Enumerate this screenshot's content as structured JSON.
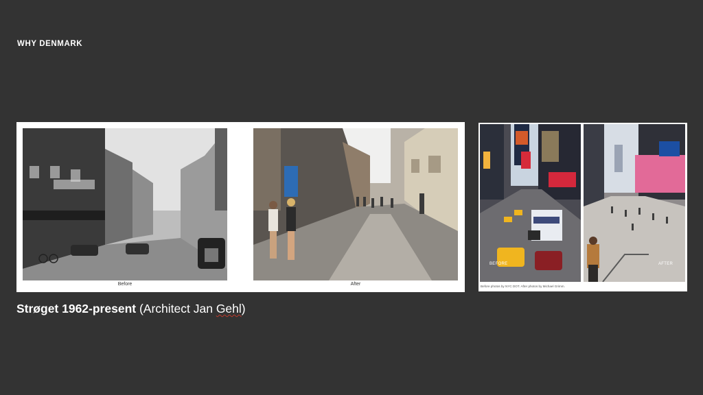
{
  "header": {
    "eyebrow": "WHY DENMARK"
  },
  "left_panel": {
    "before_caption": "Before",
    "after_caption": "After"
  },
  "right_panel": {
    "before_label": "BEFORE",
    "after_label": "AFTER",
    "credit": "Before photos by NYC DOT. After photos by Michael Grimm."
  },
  "title": {
    "strong": "Strøget 1962-present",
    "open": " (Architect Jan ",
    "name": "Gehl",
    "close": ")"
  },
  "colors": {
    "background": "#333333",
    "text": "#ffffff",
    "panel": "#ffffff"
  }
}
